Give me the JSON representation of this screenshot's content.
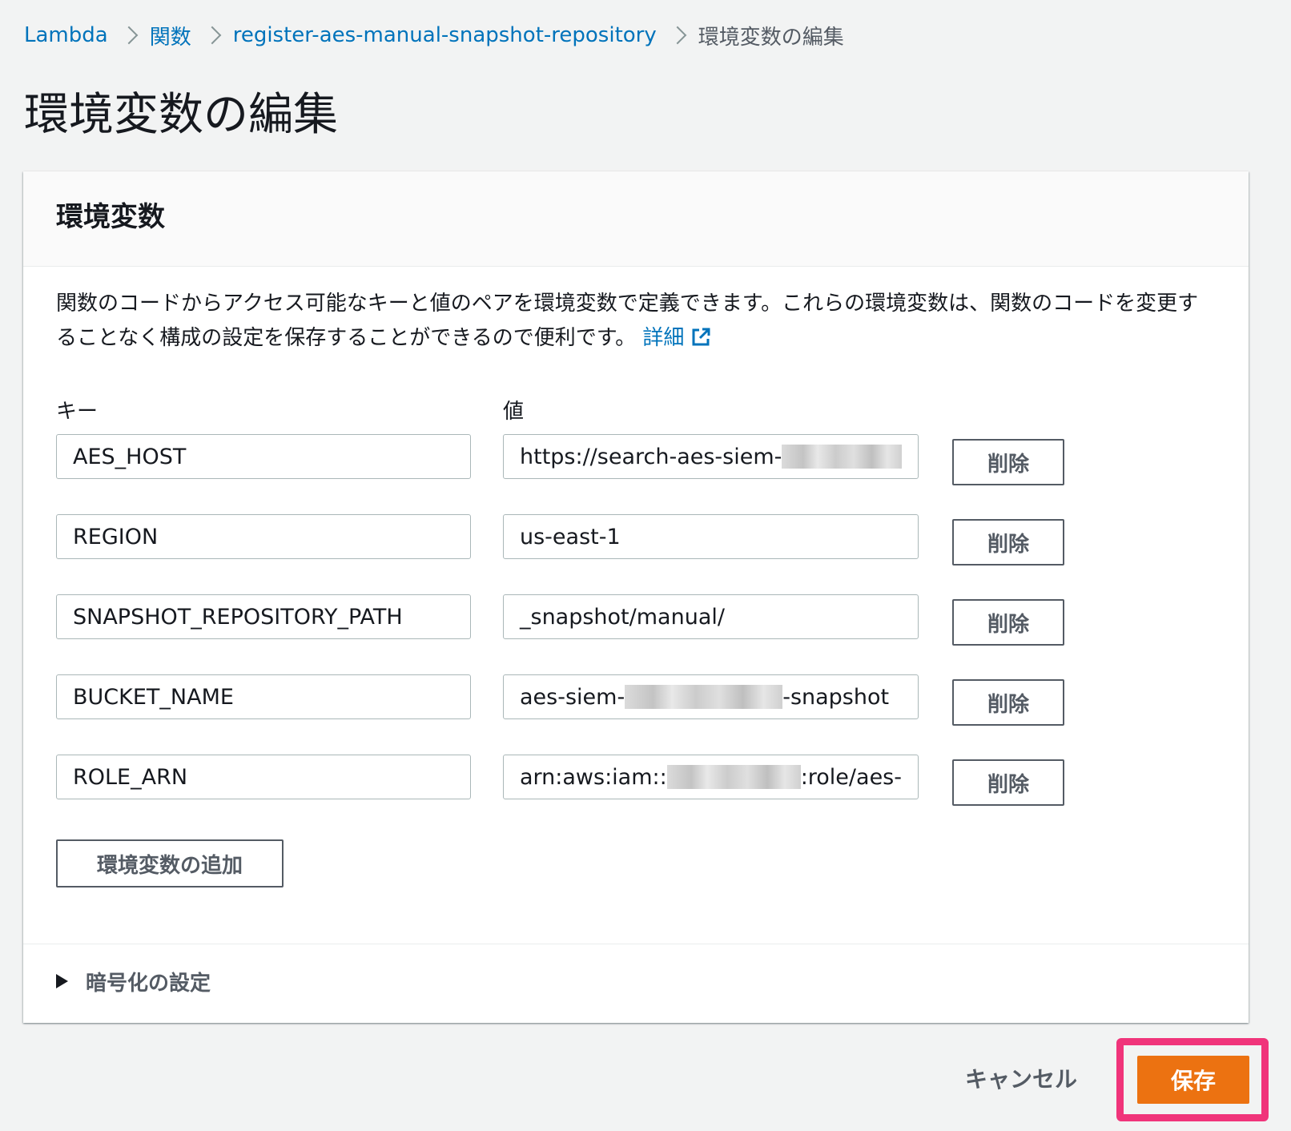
{
  "breadcrumb": {
    "items": [
      "Lambda",
      "関数",
      "register-aes-manual-snapshot-repository"
    ],
    "current": "環境変数の編集"
  },
  "page": {
    "title": "環境変数の編集"
  },
  "panel": {
    "heading": "環境変数",
    "description": "関数のコードからアクセス可能なキーと値のペアを環境変数で定義できます。これらの環境変数は、関数のコードを変更することなく構成の設定を保存することができるので便利です。",
    "learn_more": "詳細",
    "key_label": "キー",
    "value_label": "値",
    "variables": [
      {
        "key": "AES_HOST",
        "value_prefix": "https://search-aes-siem-",
        "value_suffix": ""
      },
      {
        "key": "REGION",
        "value_prefix": "us-east-1",
        "value_suffix": ""
      },
      {
        "key": "SNAPSHOT_REPOSITORY_PATH",
        "value_prefix": "_snapshot/manual/",
        "value_suffix": ""
      },
      {
        "key": "BUCKET_NAME",
        "value_prefix": "aes-siem-",
        "value_suffix": "-snapshot"
      },
      {
        "key": "ROLE_ARN",
        "value_prefix": "arn:aws:iam::",
        "value_suffix": ":role/aes-"
      }
    ],
    "remove_label": "削除",
    "add_label": "環境変数の追加",
    "encryption_label": "暗号化の設定"
  },
  "footer": {
    "cancel_label": "キャンセル",
    "save_label": "保存"
  },
  "colors": {
    "link": "#0073bb",
    "primary_button": "#ec7211",
    "highlight": "#f0347a",
    "background": "#f2f3f3"
  },
  "icons": {
    "external_link": "external-link-icon",
    "breadcrumb_separator": "chevron-right-icon",
    "expander": "caret-right-icon"
  }
}
